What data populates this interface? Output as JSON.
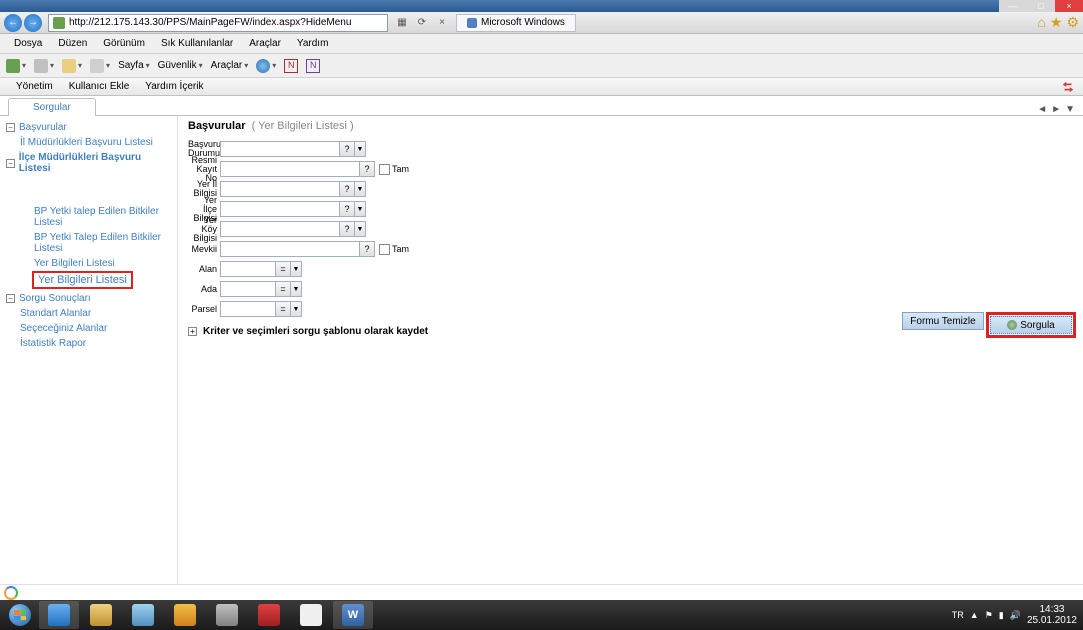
{
  "window_controls": {
    "min": "—",
    "max": "□",
    "close": "×"
  },
  "ie": {
    "back": "←",
    "forward": "→",
    "url": "http://212.175.143.30/PPS/MainPageFW/index.aspx?HideMenu",
    "refresh": "⟳",
    "stop": "×",
    "search": "🔍",
    "tab_title": "Microsoft Windows"
  },
  "browser_menu": [
    "Dosya",
    "Düzen",
    "Görünüm",
    "Sık Kullanılanlar",
    "Araçlar",
    "Yardım"
  ],
  "toolbar": [
    "Sayfa",
    "Güvenlik",
    "Araçlar"
  ],
  "app_menu": [
    "Yönetim",
    "Kullanıcı Ekle",
    "Yardım İçerik"
  ],
  "page_tab": "Sorgular",
  "tab_nav": {
    "left": "◄",
    "right": "►",
    "down": "▼"
  },
  "tree": {
    "root": "Başvurular",
    "item1": "İl Müdürlükleri Başvuru Listesi",
    "item2": "İlçe Müdürlükleri Başvuru Listesi",
    "item3": "BP Yetki talep Edilen Bitkiler Listesi",
    "item4": "BP Yetki Talep Edilen Bitkiler Listesi",
    "item5": "Yer Bilgileri Listesi",
    "item6": "Yer Bilgileri Listesi",
    "root2": "Sorgu Sonuçları",
    "sub1": "Standart Alanlar",
    "sub2": "Seçeceğiniz Alanlar",
    "sub3": "İstatistik Rapor"
  },
  "form": {
    "title_main": "Başvurular",
    "title_sub": "( Yer Bilgileri Listesi )",
    "labels": {
      "basvuru_durumu": "Başvuru Durumu",
      "resmi_kayit": "Resmi Kayıt No",
      "yer_il": "Yer İl Bilgisi",
      "yer_ilce": "Yer İlçe Bilgisi",
      "yer_koy": "Yer Köy Bilgisi",
      "mevkii": "Mevkii",
      "alan": "Alan",
      "ada": "Ada",
      "parsel": "Parsel"
    },
    "tam": "Tam",
    "eq": "=",
    "q": "?",
    "dd": "▼",
    "section": "Kriter ve seçimleri sorgu şablonu olarak kaydet",
    "btn_clear": "Formu Temizle",
    "btn_query": "Sorgula"
  },
  "systray": {
    "lang": "TR",
    "up": "▲",
    "flag": "⚑",
    "net": "▮",
    "vol": "🔊",
    "time": "14:33",
    "date": "25.01.2012"
  }
}
